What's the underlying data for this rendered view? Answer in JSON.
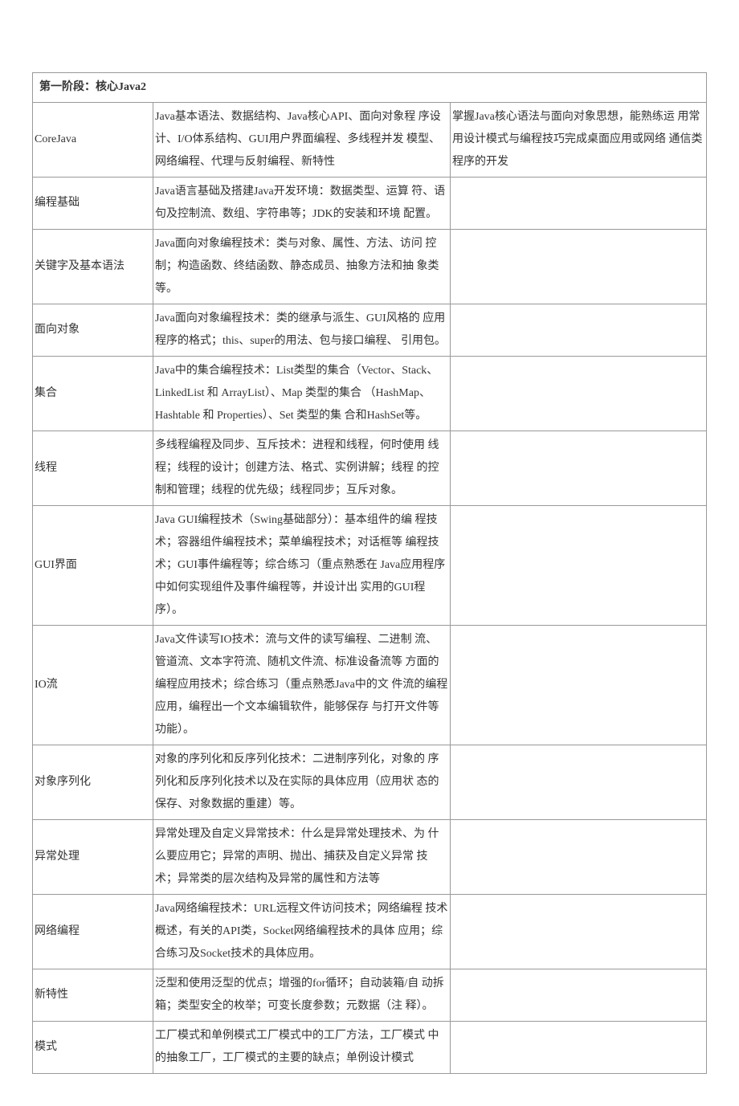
{
  "header": "第一阶段：核心Java2",
  "rows": [
    {
      "c1": "CoreJava",
      "c2": "Java基本语法、数据结构、Java核心API、面向对象程 序设计、I/O体系结构、GUI用户界面编程、多线程并发 模型、网络编程、代理与反射编程、新特性",
      "c3": "掌握Java核心语法与面向对象思想，能熟练运 用常用设计模式与编程技巧完成桌面应用或网络 通信类程序的开发"
    },
    {
      "c1": "编程基础",
      "c2": "Java语言基础及搭建Java开发环境：数据类型、运算 符、语句及控制流、数组、字符串等；JDK的安装和环境 配置。",
      "c3": ""
    },
    {
      "c1": "关键字及基本语法",
      "c2": "Java面向对象编程技术：类与对象、属性、方法、访问 控制；构造函数、终结函数、静态成员、抽象方法和抽 象类等。",
      "c3": ""
    },
    {
      "c1": "面向对象",
      "c2": "Java面向对象编程技术：类的继承与派生、GUI风格的 应用程序的格式；this、super的用法、包与接口编程、 引用包。",
      "c3": ""
    },
    {
      "c1": "集合",
      "c2": "Java中的集合编程技术：List类型的集合（Vector、Stack、LinkedList 和 ArrayList）、Map 类型的集合 （HashMap、Hashtable 和 Properties）、Set 类型的集 合和HashSet等。",
      "c3": ""
    },
    {
      "c1": "线程",
      "c2": "多线程编程及同步、互斥技术：进程和线程，何时使用 线程；线程的设计；创建方法、格式、实例讲解；线程 的控制和管理；线程的优先级；线程同步；互斥对象。",
      "c3": ""
    },
    {
      "c1": "GUI界面",
      "c2": "Java GUI编程技术（Swing基础部分）：基本组件的编 程技术；容器组件编程技术；菜单编程技术；对话框等 编程技术；GUI事件编程等；综合练习（重点熟悉在 Java应用程序中如何实现组件及事件编程等，并设计出 实用的GUI程序）。",
      "c3": ""
    },
    {
      "c1": "IO流",
      "c2": "Java文件读写IO技术：流与文件的读写编程、二进制 流、管道流、文本字符流、随机文件流、标准设备流等 方面的编程应用技术；综合练习（重点熟悉Java中的文 件流的编程应用，编程出一个文本编辑软件，能够保存 与打开文件等功能）。",
      "c3": ""
    },
    {
      "c1": "对象序列化",
      "c2": "对象的序列化和反序列化技术：二进制序列化，对象的 序列化和反序列化技术以及在实际的具体应用（应用状 态的保存、对象数据的重建）等。",
      "c3": ""
    },
    {
      "c1": "异常处理",
      "c2": "异常处理及自定义异常技术：什么是异常处理技术、为 什么要应用它；异常的声明、抛出、捕获及自定义异常 技术；异常类的层次结构及异常的属性和方法等",
      "c3": ""
    },
    {
      "c1": "网络编程",
      "c2": "Java网络编程技术：URL远程文件访问技术；网络编程 技术概述，有关的API类，Socket网络编程技术的具体 应用；综合练习及Socket技术的具体应用。",
      "c3": ""
    },
    {
      "c1": "新特性",
      "c2": "泛型和使用泛型的优点；增强的for循环；自动装箱/自 动拆箱；类型安全的枚举；可变长度参数；元数据（注 释）。",
      "c3": ""
    },
    {
      "c1": "模式",
      "c2": "工厂模式和单例模式工厂模式中的工厂方法，工厂模式 中的抽象工厂，工厂模式的主要的缺点；单例设计模式",
      "c3": ""
    }
  ]
}
